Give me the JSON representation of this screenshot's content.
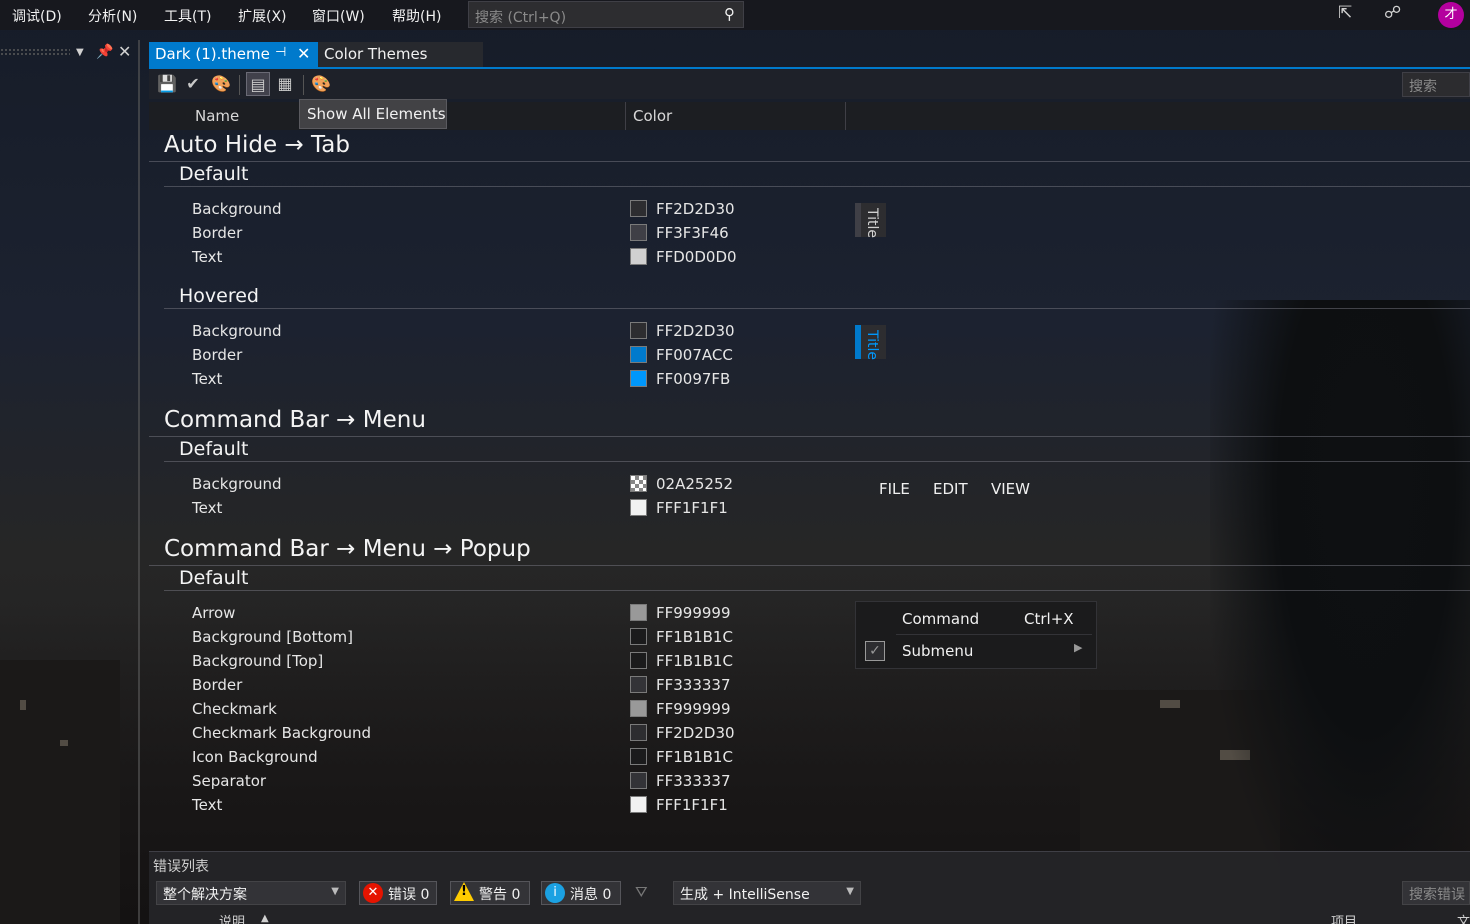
{
  "menubar": {
    "items": [
      "调试(D)",
      "分析(N)",
      "工具(T)",
      "扩展(X)",
      "窗口(W)",
      "帮助(H)"
    ],
    "search_placeholder": "搜索 (Ctrl+Q)",
    "avatar_initial": "才"
  },
  "tabs": {
    "active": "Dark (1).theme",
    "second": "Color Themes"
  },
  "toolbar": {
    "tooltip": "Show All Elements",
    "search_placeholder": "搜索"
  },
  "columns": {
    "name": "Name",
    "color": "Color"
  },
  "sections": {
    "s1": {
      "title": "Auto Hide → Tab",
      "g1": {
        "title": "Default",
        "rows": [
          {
            "name": "Background",
            "hex": "FF2D2D30",
            "color": "#2D2D30"
          },
          {
            "name": "Border",
            "hex": "FF3F3F46",
            "color": "#3F3F46"
          },
          {
            "name": "Text",
            "hex": "FFD0D0D0",
            "color": "#D0D0D0"
          }
        ],
        "preview": "Title"
      },
      "g2": {
        "title": "Hovered",
        "rows": [
          {
            "name": "Background",
            "hex": "FF2D2D30",
            "color": "#2D2D30"
          },
          {
            "name": "Border",
            "hex": "FF007ACC",
            "color": "#007ACC"
          },
          {
            "name": "Text",
            "hex": "FF0097FB",
            "color": "#0097FB"
          }
        ],
        "preview": "Title"
      }
    },
    "s2": {
      "title": "Command Bar → Menu",
      "g1": {
        "title": "Default",
        "rows": [
          {
            "name": "Background",
            "hex": "02A25252",
            "color": "checker"
          },
          {
            "name": "Text",
            "hex": "FFF1F1F1",
            "color": "#F1F1F1"
          }
        ],
        "preview_items": [
          "FILE",
          "EDIT",
          "VIEW"
        ]
      }
    },
    "s3": {
      "title": "Command Bar → Menu → Popup",
      "g1": {
        "title": "Default",
        "rows": [
          {
            "name": "Arrow",
            "hex": "FF999999",
            "color": "#999999"
          },
          {
            "name": "Background [Bottom]",
            "hex": "FF1B1B1C",
            "color": "#1B1B1C"
          },
          {
            "name": "Background [Top]",
            "hex": "FF1B1B1C",
            "color": "#1B1B1C"
          },
          {
            "name": "Border",
            "hex": "FF333337",
            "color": "#333337"
          },
          {
            "name": "Checkmark",
            "hex": "FF999999",
            "color": "#999999"
          },
          {
            "name": "Checkmark Background",
            "hex": "FF2D2D30",
            "color": "#2D2D30"
          },
          {
            "name": "Icon Background",
            "hex": "FF1B1B1C",
            "color": "#1B1B1C"
          },
          {
            "name": "Separator",
            "hex": "FF333337",
            "color": "#333337"
          },
          {
            "name": "Text",
            "hex": "FFF1F1F1",
            "color": "#F1F1F1"
          }
        ],
        "popup": {
          "command": "Command",
          "shortcut": "Ctrl+X",
          "submenu": "Submenu"
        }
      }
    }
  },
  "errorlist": {
    "title": "错误列表",
    "scope": "整个解决方案",
    "errors": "错误 0",
    "warnings": "警告 0",
    "messages": "消息 0",
    "build": "生成 + IntelliSense",
    "search": "搜索错误",
    "col_desc": "说明",
    "col_project": "项目",
    "col_file": "文"
  }
}
